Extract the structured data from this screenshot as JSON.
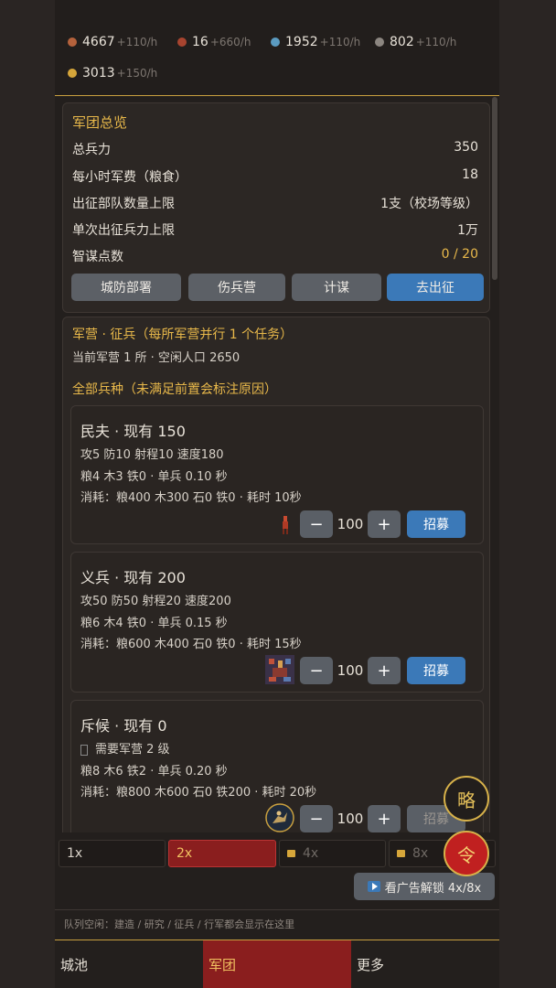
{
  "resources": [
    {
      "icon": "meat-icon",
      "value": "4667",
      "rate": "+110/h",
      "color": "#b5623c"
    },
    {
      "icon": "wood-icon",
      "value": "16",
      "rate": "+660/h",
      "color": "#a8442f"
    },
    {
      "icon": "iron-icon",
      "value": "1952",
      "rate": "+110/h",
      "color": "#5b9bc0"
    },
    {
      "icon": "stone-icon",
      "value": "802",
      "rate": "+110/h",
      "color": "#8c8680"
    },
    {
      "icon": "gold-icon",
      "value": "3013",
      "rate": "+150/h",
      "color": "#d6a63a"
    }
  ],
  "overview": {
    "title": "军团总览",
    "rows": [
      {
        "label": "总兵力",
        "value": "350"
      },
      {
        "label": "每小时军费（粮食）",
        "value": "18"
      },
      {
        "label": "出征部队数量上限",
        "value": "1支（校场等级）"
      },
      {
        "label": "单次出征兵力上限",
        "value": "1万"
      },
      {
        "label": "智谋点数",
        "value": "0 / 20"
      }
    ],
    "buttons": [
      "城防部署",
      "伤兵营",
      "计谋",
      "去出征"
    ]
  },
  "barracks": {
    "title": "军营 · 征兵（每所军营并行 1 个任务）",
    "subtitle": "当前军营 1 所 · 空闲人口 2650",
    "section_title": "全部兵种（未满足前置会标注原因）"
  },
  "units": [
    {
      "title": "民夫 · 现有 150",
      "stats": "攻5 防10 射程10 速度180",
      "cost": "粮4 木3 铁0 · 单兵 0.10 秒",
      "consume": "消耗：粮400 木300 石0 铁0 · 耗时 10秒",
      "qty": "100",
      "minus": "−",
      "plus": "+",
      "recruit": "招募"
    },
    {
      "title": "义兵 · 现有 200",
      "stats": "攻50 防50 射程20 速度200",
      "cost": "粮6 木4 铁0 · 单兵 0.15 秒",
      "consume": "消耗：粮600 木400 石0 铁0 · 耗时 15秒",
      "qty": "100",
      "minus": "−",
      "plus": "+",
      "recruit": "招募"
    },
    {
      "title": "斥候 · 现有 0",
      "requirement": "需要军营 2 级",
      "cost": "粮8 木6 铁2 · 单兵 0.20 秒",
      "consume": "消耗：粮800 木600 石0 铁200 · 耗时 20秒",
      "qty": "100",
      "minus": "−",
      "plus": "+",
      "recruit": "招募"
    }
  ],
  "speed": {
    "options": [
      {
        "label": "1x",
        "state": "normal"
      },
      {
        "label": "2x",
        "state": "active"
      },
      {
        "label": "4x",
        "state": "locked"
      },
      {
        "label": "8x",
        "state": "locked"
      }
    ],
    "ad_button": "看广告解锁 4x/8x"
  },
  "fab": {
    "strategy": "略",
    "order": "令"
  },
  "queue_text": "队列空闲：建造 / 研究 / 征兵 / 行军都会显示在这里",
  "nav": [
    "城池",
    "军团",
    "更多"
  ],
  "colors": {
    "gold": "#e8b84a",
    "blue": "#3b79b8",
    "red": "#8a1e1e"
  }
}
